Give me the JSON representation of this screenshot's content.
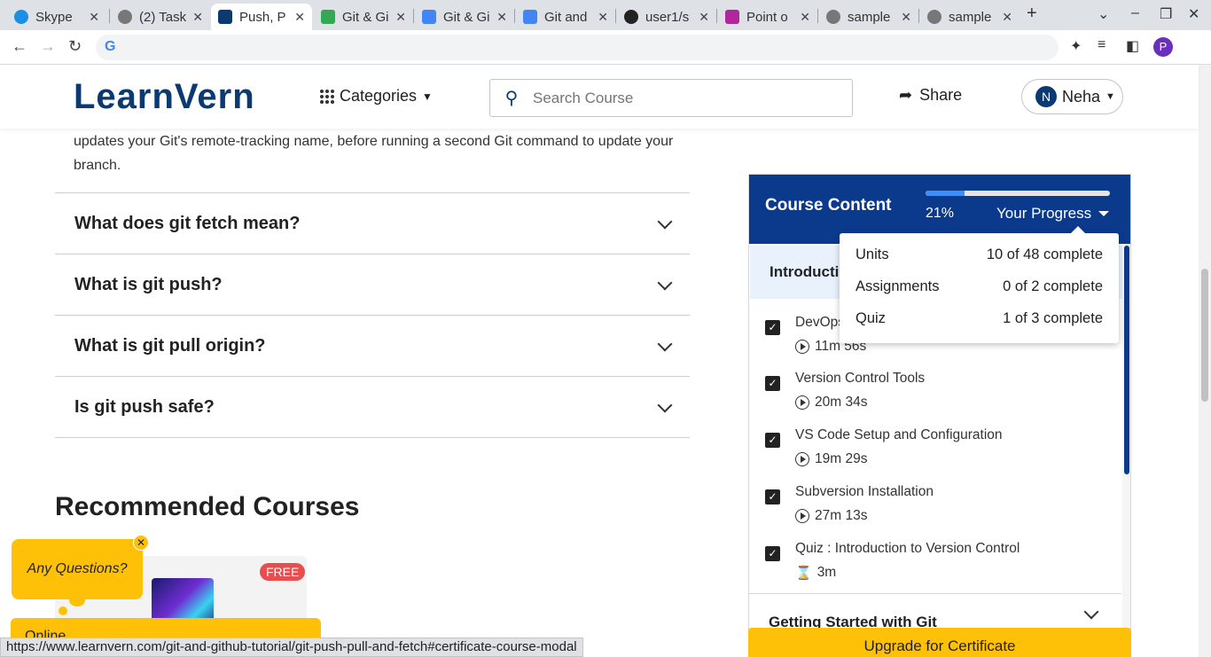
{
  "browser": {
    "tabs": [
      {
        "title": "Skype",
        "icon_color": "#1a8fe3",
        "active": false
      },
      {
        "title": "(2) Task",
        "icon_color": "#555555",
        "active": false
      },
      {
        "title": "Push, P",
        "icon_color": "#0b3a72",
        "active": true
      },
      {
        "title": "Git & Gi",
        "icon_color": "#34a853",
        "active": false
      },
      {
        "title": "Git & Gi",
        "icon_color": "#4285f4",
        "active": false
      },
      {
        "title": "Git and",
        "icon_color": "#4285f4",
        "active": false
      },
      {
        "title": "user1/s",
        "icon_color": "#222222",
        "active": false
      },
      {
        "title": "Point o",
        "icon_color": "#b0279c",
        "active": false
      },
      {
        "title": "sample",
        "icon_color": "#555555",
        "active": false
      },
      {
        "title": "sample",
        "icon_color": "#555555",
        "active": false
      }
    ],
    "new_tab": "+",
    "address": "",
    "profile_initial": "P",
    "status_url": "https://www.learnvern.com/git-and-github-tutorial/git-push-pull-and-fetch#certificate-course-modal"
  },
  "header": {
    "logo": "LearnVern",
    "categories": "Categories",
    "search_placeholder": "Search Course",
    "share": "Share",
    "user_initial": "N",
    "user_name": "Neha"
  },
  "content": {
    "intro_text": "updates your Git's remote-tracking name, before running a second Git command to update your branch.",
    "faqs": [
      {
        "question": "What does git fetch mean?"
      },
      {
        "question": "What is git push?"
      },
      {
        "question": "What is git pull origin?"
      },
      {
        "question": "Is git push safe?"
      }
    ],
    "recommended_heading": "Recommended Courses",
    "free_badge": "FREE"
  },
  "widgets": {
    "questions_label": "Any Questions?",
    "online_label": "Online"
  },
  "course_panel": {
    "title": "Course Content",
    "progress_pct_label": "21%",
    "progress_fraction": 0.21,
    "your_progress": "Your Progress",
    "intro_section": "Introduction",
    "items": [
      {
        "title": "DevOps",
        "duration": "11m 56s",
        "kind": "video"
      },
      {
        "title": "Version Control Tools",
        "duration": "20m 34s",
        "kind": "video"
      },
      {
        "title": "VS Code Setup and Configuration",
        "duration": "19m 29s",
        "kind": "video"
      },
      {
        "title": "Subversion Installation",
        "duration": "27m 13s",
        "kind": "video"
      },
      {
        "title": "Quiz : Introduction to Version Control",
        "duration": "3m",
        "kind": "quiz"
      }
    ],
    "next_section": "Getting Started with Git",
    "upgrade_label": "Upgrade for Certificate"
  },
  "progress_dropdown": {
    "rows": [
      {
        "label": "Units",
        "value": "10 of 48 complete"
      },
      {
        "label": "Assignments",
        "value": "0 of 2 complete"
      },
      {
        "label": "Quiz",
        "value": "1 of 3 complete"
      }
    ]
  }
}
